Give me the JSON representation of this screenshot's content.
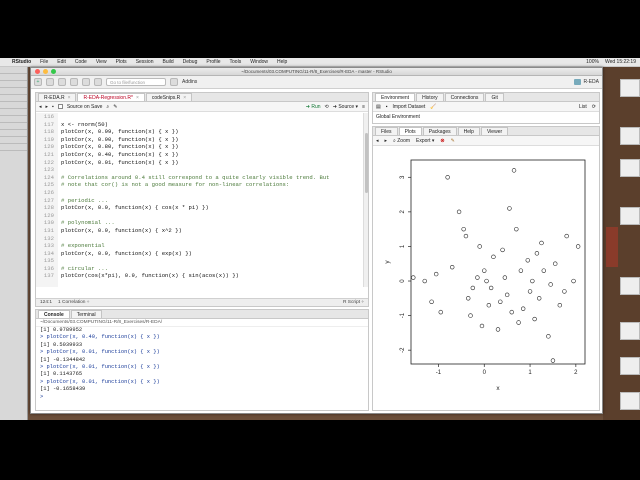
{
  "menubar": {
    "apple": "",
    "items": [
      "RStudio",
      "File",
      "Edit",
      "Code",
      "View",
      "Plots",
      "Session",
      "Build",
      "Debug",
      "Profile",
      "Tools",
      "Window",
      "Help"
    ],
    "status": "100%",
    "clock": "Wed 15:22:19"
  },
  "window": {
    "title": "~/Documents/03.COMPUTING/11-R/8_Exercises/R-EDA - master - RStudio",
    "goto_placeholder": "Go to file/function",
    "addins": "Addins",
    "project": "R-EDA"
  },
  "editor": {
    "tabs": [
      "R-EDA.R",
      "R-EDA-Regression.R*",
      "codeSnips.R"
    ],
    "source_on_save": "Source on Save",
    "run": "Run",
    "source": "Source",
    "lines": [
      {
        "n": "116",
        "t": "",
        "c": false
      },
      {
        "n": "117",
        "t": "x <- rnorm(50)",
        "c": false
      },
      {
        "n": "118",
        "t": "plotCor(x, 0.99, function(x) { x })",
        "c": false
      },
      {
        "n": "119",
        "t": "plotCor(x, 0.90, function(x) { x })",
        "c": false
      },
      {
        "n": "120",
        "t": "plotCor(x, 0.80, function(x) { x })",
        "c": false
      },
      {
        "n": "121",
        "t": "plotCor(x, 0.40, function(x) { x })",
        "c": false
      },
      {
        "n": "122",
        "t": "plotCor(x, 0.01, function(x) { x })",
        "c": false
      },
      {
        "n": "123",
        "t": "",
        "c": false
      },
      {
        "n": "124",
        "t": "# Correlations around 0.4 still correspond to a quite clearly visible trend. But",
        "c": true
      },
      {
        "n": "125",
        "t": "# note that cor() is not a good measure for non-linear correlations:",
        "c": true
      },
      {
        "n": "126",
        "t": "",
        "c": false
      },
      {
        "n": "127",
        "t": "# periodic ...",
        "c": true
      },
      {
        "n": "128",
        "t": "plotCor(x, 0.9, function(x) { cos(x * pi) })",
        "c": false
      },
      {
        "n": "129",
        "t": "",
        "c": false
      },
      {
        "n": "130",
        "t": "# polynomial ...",
        "c": true
      },
      {
        "n": "131",
        "t": "plotCor(x, 0.9, function(x) { x^2 })",
        "c": false
      },
      {
        "n": "132",
        "t": "",
        "c": false
      },
      {
        "n": "133",
        "t": "# exponential",
        "c": true
      },
      {
        "n": "134",
        "t": "plotCor(x, 0.9, function(x) { exp(x) })",
        "c": false
      },
      {
        "n": "135",
        "t": "",
        "c": false
      },
      {
        "n": "136",
        "t": "# circular ...",
        "c": true
      },
      {
        "n": "137",
        "t": "plotCor(cos(x*pi), 0.9, function(x) { sin(acos(x)) })",
        "c": false
      }
    ],
    "status_pos": "124:1",
    "status_section": "1 Correlation ÷",
    "status_type": "R Script ÷"
  },
  "console": {
    "tabs": [
      "Console",
      "Terminal"
    ],
    "path": "~/Documents/03.COMPUTING/11-R/8_Exercises/R-EDA/",
    "lines": [
      {
        "t": "[1] 0.9789952",
        "cmd": false
      },
      {
        "t": "> plotCor(x, 0.40, function(x) { x })",
        "cmd": true
      },
      {
        "t": "[1] 0.5039933",
        "cmd": false
      },
      {
        "t": "> plotCor(x, 0.01, function(x) { x })",
        "cmd": true
      },
      {
        "t": "[1] -0.1344842",
        "cmd": false
      },
      {
        "t": "> plotCor(x, 0.01, function(x) { x })",
        "cmd": true
      },
      {
        "t": "[1] 0.1143765",
        "cmd": false
      },
      {
        "t": "> plotCor(x, 0.01, function(x) { x })",
        "cmd": true
      },
      {
        "t": "[1] -0.1658439",
        "cmd": false
      },
      {
        "t": ">",
        "cmd": true
      }
    ]
  },
  "environment": {
    "tabs": [
      "Environment",
      "History",
      "Connections",
      "Git"
    ],
    "import": "Import Dataset",
    "list": "List",
    "scope": "Global Environment"
  },
  "plots": {
    "tabs": [
      "Files",
      "Plots",
      "Packages",
      "Help",
      "Viewer"
    ],
    "zoom": "Zoom",
    "export": "Export"
  },
  "chart_data": {
    "type": "scatter",
    "xlabel": "x",
    "ylabel": "y",
    "xlim": [
      -1.6,
      2.2
    ],
    "ylim": [
      -2.4,
      3.5
    ],
    "xticks": [
      -1,
      0,
      1,
      2
    ],
    "yticks": [
      -2,
      -1,
      0,
      1,
      2,
      3
    ],
    "points": [
      [
        -1.55,
        0.1
      ],
      [
        -1.3,
        0.0
      ],
      [
        -1.15,
        -0.6
      ],
      [
        -1.05,
        0.2
      ],
      [
        -0.8,
        3.0
      ],
      [
        -0.7,
        0.4
      ],
      [
        -0.55,
        2.0
      ],
      [
        -0.45,
        1.5
      ],
      [
        -0.4,
        1.3
      ],
      [
        -0.35,
        -0.5
      ],
      [
        -0.3,
        -1.0
      ],
      [
        -0.25,
        -0.2
      ],
      [
        -0.15,
        0.1
      ],
      [
        -0.1,
        1.0
      ],
      [
        -0.05,
        -1.3
      ],
      [
        0.0,
        0.3
      ],
      [
        0.05,
        0.0
      ],
      [
        0.1,
        -0.7
      ],
      [
        0.15,
        -0.2
      ],
      [
        0.2,
        0.7
      ],
      [
        0.3,
        -1.4
      ],
      [
        0.35,
        -0.6
      ],
      [
        0.4,
        0.9
      ],
      [
        0.45,
        0.1
      ],
      [
        0.5,
        -0.4
      ],
      [
        0.55,
        2.1
      ],
      [
        0.6,
        -0.9
      ],
      [
        0.65,
        3.2
      ],
      [
        0.7,
        1.5
      ],
      [
        0.75,
        -1.2
      ],
      [
        0.8,
        0.3
      ],
      [
        0.85,
        -0.8
      ],
      [
        0.95,
        0.6
      ],
      [
        1.0,
        -0.3
      ],
      [
        1.05,
        0.0
      ],
      [
        1.1,
        -1.1
      ],
      [
        1.15,
        0.8
      ],
      [
        1.2,
        -0.5
      ],
      [
        1.25,
        1.1
      ],
      [
        1.3,
        0.3
      ],
      [
        1.4,
        -1.6
      ],
      [
        1.45,
        -0.1
      ],
      [
        1.5,
        -2.3
      ],
      [
        1.55,
        0.5
      ],
      [
        1.65,
        -0.7
      ],
      [
        1.75,
        -0.3
      ],
      [
        1.8,
        1.3
      ],
      [
        1.95,
        0.0
      ],
      [
        2.05,
        1.0
      ],
      [
        -0.95,
        -0.9
      ]
    ]
  }
}
